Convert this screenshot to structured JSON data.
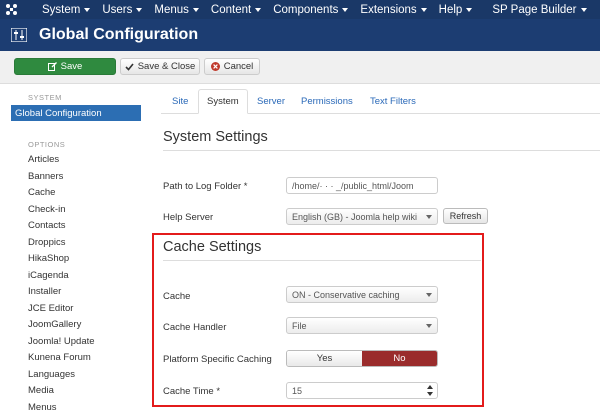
{
  "topnav": {
    "items": [
      {
        "label": "System"
      },
      {
        "label": "Users"
      },
      {
        "label": "Menus"
      },
      {
        "label": "Content"
      },
      {
        "label": "Components"
      },
      {
        "label": "Extensions"
      },
      {
        "label": "Help"
      },
      {
        "label": "SP Page Builder"
      }
    ]
  },
  "header": {
    "title": "Global Configuration"
  },
  "toolbar": {
    "save_label": "Save",
    "save_close_label": "Save & Close",
    "cancel_label": "Cancel"
  },
  "sidebar": {
    "system_heading": "SYSTEM",
    "active_item": "Global Configuration",
    "options_heading": "OPTIONS",
    "items": [
      "Articles",
      "Banners",
      "Cache",
      "Check-in",
      "Contacts",
      "Droppics",
      "HikaShop",
      "iCagenda",
      "Installer",
      "JCE Editor",
      "JoomGallery",
      "Joomla! Update",
      "Kunena Forum",
      "Languages",
      "Media",
      "Menus"
    ]
  },
  "tabs": [
    "Site",
    "System",
    "Server",
    "Permissions",
    "Text Filters"
  ],
  "active_tab": "System",
  "system_settings": {
    "title": "System Settings",
    "log_folder_label": "Path to Log Folder *",
    "log_folder_value": "/home/·  ·  ·  _/public_html/Joom",
    "help_server_label": "Help Server",
    "help_server_value": "English (GB) - Joomla help wiki",
    "refresh_label": "Refresh"
  },
  "cache_settings": {
    "title": "Cache Settings",
    "cache_label": "Cache",
    "cache_value": "ON - Conservative caching",
    "handler_label": "Cache Handler",
    "handler_value": "File",
    "platform_label": "Platform Specific Caching",
    "yes_label": "Yes",
    "no_label": "No",
    "time_label": "Cache Time *",
    "time_value": "15"
  },
  "colors": {
    "nav_bg": "#1a3867",
    "header_bg": "#1c3d72",
    "save_green": "#2f8a3f",
    "active_blue": "#2c6eb3",
    "no_red": "#9a2c2c",
    "highlight_red": "#e31b1b"
  }
}
